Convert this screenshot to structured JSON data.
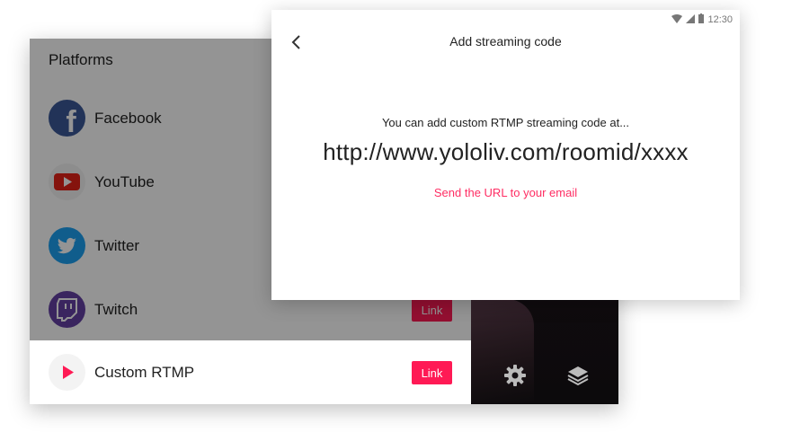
{
  "platforms": {
    "title": "Platforms",
    "items": [
      {
        "name": "Facebook",
        "icon": "facebook-icon",
        "color": "#3b5998"
      },
      {
        "name": "YouTube",
        "icon": "youtube-icon",
        "color": "#e62117"
      },
      {
        "name": "Twitter",
        "icon": "twitter-icon",
        "color": "#1da1f2"
      },
      {
        "name": "Twitch",
        "icon": "twitch-icon",
        "color": "#6441a4",
        "link_label": "Link"
      },
      {
        "name": "Custom RTMP",
        "icon": "play-icon",
        "color": "#ff1a55",
        "link_label": "Link"
      }
    ]
  },
  "preview": {
    "icons": [
      "gear-icon",
      "layers-icon"
    ]
  },
  "modal": {
    "status_time": "12:30",
    "title": "Add streaming code",
    "description": "You can add custom RTMP streaming code at...",
    "url": "http://www.yololiv.com/roomid/xxxx",
    "email_link": "Send the URL to your email"
  },
  "colors": {
    "accent": "#ff1a55",
    "email_link": "#ff2d63"
  }
}
